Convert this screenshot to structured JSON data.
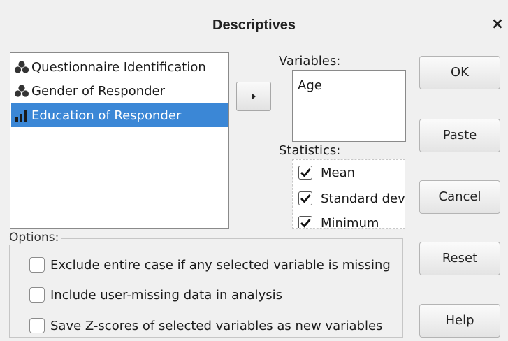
{
  "window": {
    "title": "Descriptives",
    "close_glyph": "×"
  },
  "source_list": {
    "items": [
      {
        "label": "Questionnaire Identification",
        "icon": "nominal-icon",
        "selected": false
      },
      {
        "label": "Gender of Responder",
        "icon": "nominal-icon",
        "selected": false
      },
      {
        "label": "Education of Responder",
        "icon": "ordinal-icon",
        "selected": true
      }
    ]
  },
  "variables": {
    "label": "Variables:",
    "items": [
      "Age"
    ]
  },
  "statistics": {
    "label": "Statistics:",
    "items": [
      {
        "label": "Mean",
        "checked": true
      },
      {
        "label": "Standard dev",
        "checked": true
      },
      {
        "label": "Minimum",
        "checked": true
      }
    ]
  },
  "buttons": {
    "ok": "OK",
    "paste": "Paste",
    "cancel": "Cancel",
    "reset": "Reset",
    "help": "Help"
  },
  "options": {
    "label": "Options:",
    "items": [
      {
        "label": "Exclude entire case if any selected variable is missing",
        "checked": false
      },
      {
        "label": "Include user-missing data in analysis",
        "checked": false
      },
      {
        "label": "Save Z-scores of selected variables as new variables",
        "checked": false
      }
    ]
  },
  "colors": {
    "selection": "#3b87d6",
    "background": "#f0f0f0"
  }
}
